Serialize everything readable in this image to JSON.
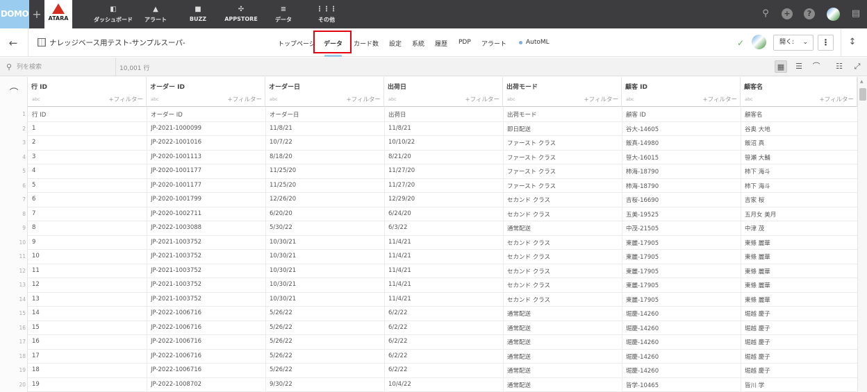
{
  "topbar": {
    "logo": "DOMO",
    "plus": "+",
    "atara_logo": "ATARA",
    "nav": [
      {
        "icon": "dashboard-icon",
        "glyph": "◧",
        "label": "ダッシュボード"
      },
      {
        "icon": "bell-icon",
        "glyph": "▲",
        "label": "アラート"
      },
      {
        "icon": "chat-icon",
        "glyph": "■",
        "label": "BUZZ"
      },
      {
        "icon": "appstore-icon",
        "glyph": "✣",
        "label": "APPSTORE"
      },
      {
        "icon": "database-icon",
        "glyph": "≡",
        "label": "データ"
      },
      {
        "icon": "grid-icon",
        "glyph": "⋮⋮⋮",
        "label": "その他"
      }
    ],
    "right_icons": {
      "search": "⚲",
      "add": "+",
      "help": "?",
      "messages": "▤"
    }
  },
  "subbar": {
    "back": "←",
    "dataset_title": "ナレッジベース用テスト-サンプルスーパ-",
    "tabs": [
      "トップページ",
      "データ",
      "カード数",
      "設定",
      "系統",
      "履歴",
      "PDP",
      "アラート",
      "AutoML"
    ],
    "active_tab": "データ",
    "check": "✓",
    "open_label": "開く:",
    "open_chevron": "⌄",
    "more": "⋮",
    "resize": "↕"
  },
  "toolbar": {
    "search_placeholder": "列を検索",
    "row_count": "10,001 行",
    "icons": {
      "table": "▦",
      "list": "☰",
      "stats": "⌒",
      "settings": "☷",
      "expand": "⤢"
    }
  },
  "table": {
    "columns": [
      {
        "name": "行 ID",
        "type": "abc",
        "filter": "+フィルター"
      },
      {
        "name": "オーダー ID",
        "type": "abc",
        "filter": "+フィルター"
      },
      {
        "name": "オーダー日",
        "type": "abc",
        "filter": "+フィルター"
      },
      {
        "name": "出荷日",
        "type": "abc",
        "filter": "+フィルター"
      },
      {
        "name": "出荷モード",
        "type": "abc",
        "filter": "+フィルター"
      },
      {
        "name": "顧客 ID",
        "type": "abc",
        "filter": "+フィルター"
      },
      {
        "name": "顧客名",
        "type": "abc",
        "filter": "+フィルター"
      }
    ],
    "row_numbers": [
      "1",
      "2",
      "3",
      "4",
      "5",
      "6",
      "7",
      "8",
      "9",
      "10",
      "11",
      "12",
      "13",
      "14",
      "15",
      "16",
      "17",
      "18",
      "19",
      "20"
    ],
    "rows": [
      [
        "行 ID",
        "オーダー ID",
        "オーダー日",
        "出荷日",
        "出荷モード",
        "顧客 ID",
        "顧客名"
      ],
      [
        "1",
        "JP-2021-1000099",
        "11/8/21",
        "11/8/21",
        "即日配送",
        "谷大-14605",
        "谷奥 大地"
      ],
      [
        "2",
        "JP-2022-1001016",
        "10/7/22",
        "10/10/22",
        "ファースト クラス",
        "飯真-14980",
        "飯沼 真"
      ],
      [
        "3",
        "JP-2020-1001113",
        "8/18/20",
        "8/21/20",
        "ファースト クラス",
        "笹大-16015",
        "笹瀬 大輔"
      ],
      [
        "4",
        "JP-2020-1001177",
        "11/25/20",
        "11/27/20",
        "ファースト クラス",
        "柿海-18790",
        "柿下 海斗"
      ],
      [
        "5",
        "JP-2020-1001177",
        "11/25/20",
        "11/27/20",
        "ファースト クラス",
        "柿海-18790",
        "柿下 海斗"
      ],
      [
        "6",
        "JP-2020-1001799",
        "12/26/20",
        "12/29/20",
        "セカンド クラス",
        "吉桜-16690",
        "吉家 桜"
      ],
      [
        "7",
        "JP-2020-1002711",
        "6/20/20",
        "6/24/20",
        "セカンド クラス",
        "五美-19525",
        "五月女 美月"
      ],
      [
        "8",
        "JP-2022-1003088",
        "5/30/22",
        "6/3/22",
        "通常配送",
        "中茂-21505",
        "中津 茂"
      ],
      [
        "9",
        "JP-2021-1003752",
        "10/30/21",
        "11/4/21",
        "セカンド クラス",
        "東麗-17905",
        "東條 麗華"
      ],
      [
        "10",
        "JP-2021-1003752",
        "10/30/21",
        "11/4/21",
        "セカンド クラス",
        "東麗-17905",
        "東條 麗華"
      ],
      [
        "11",
        "JP-2021-1003752",
        "10/30/21",
        "11/4/21",
        "セカンド クラス",
        "東麗-17905",
        "東條 麗華"
      ],
      [
        "12",
        "JP-2021-1003752",
        "10/30/21",
        "11/4/21",
        "セカンド クラス",
        "東麗-17905",
        "東條 麗華"
      ],
      [
        "13",
        "JP-2021-1003752",
        "10/30/21",
        "11/4/21",
        "セカンド クラス",
        "東麗-17905",
        "東條 麗華"
      ],
      [
        "14",
        "JP-2022-1006716",
        "5/26/22",
        "6/2/22",
        "通常配送",
        "堀慶-14260",
        "堀越 慶子"
      ],
      [
        "15",
        "JP-2022-1006716",
        "5/26/22",
        "6/2/22",
        "通常配送",
        "堀慶-14260",
        "堀越 慶子"
      ],
      [
        "16",
        "JP-2022-1006716",
        "5/26/22",
        "6/2/22",
        "通常配送",
        "堀慶-14260",
        "堀越 慶子"
      ],
      [
        "17",
        "JP-2022-1006716",
        "5/26/22",
        "6/2/22",
        "通常配送",
        "堀慶-14260",
        "堀越 慶子"
      ],
      [
        "18",
        "JP-2022-1006716",
        "5/26/22",
        "6/2/22",
        "通常配送",
        "堀慶-14260",
        "堀越 慶子"
      ],
      [
        "19",
        "JP-2022-1008702",
        "9/30/22",
        "10/4/22",
        "通常配送",
        "皆学-10465",
        "皆川 学"
      ]
    ]
  }
}
